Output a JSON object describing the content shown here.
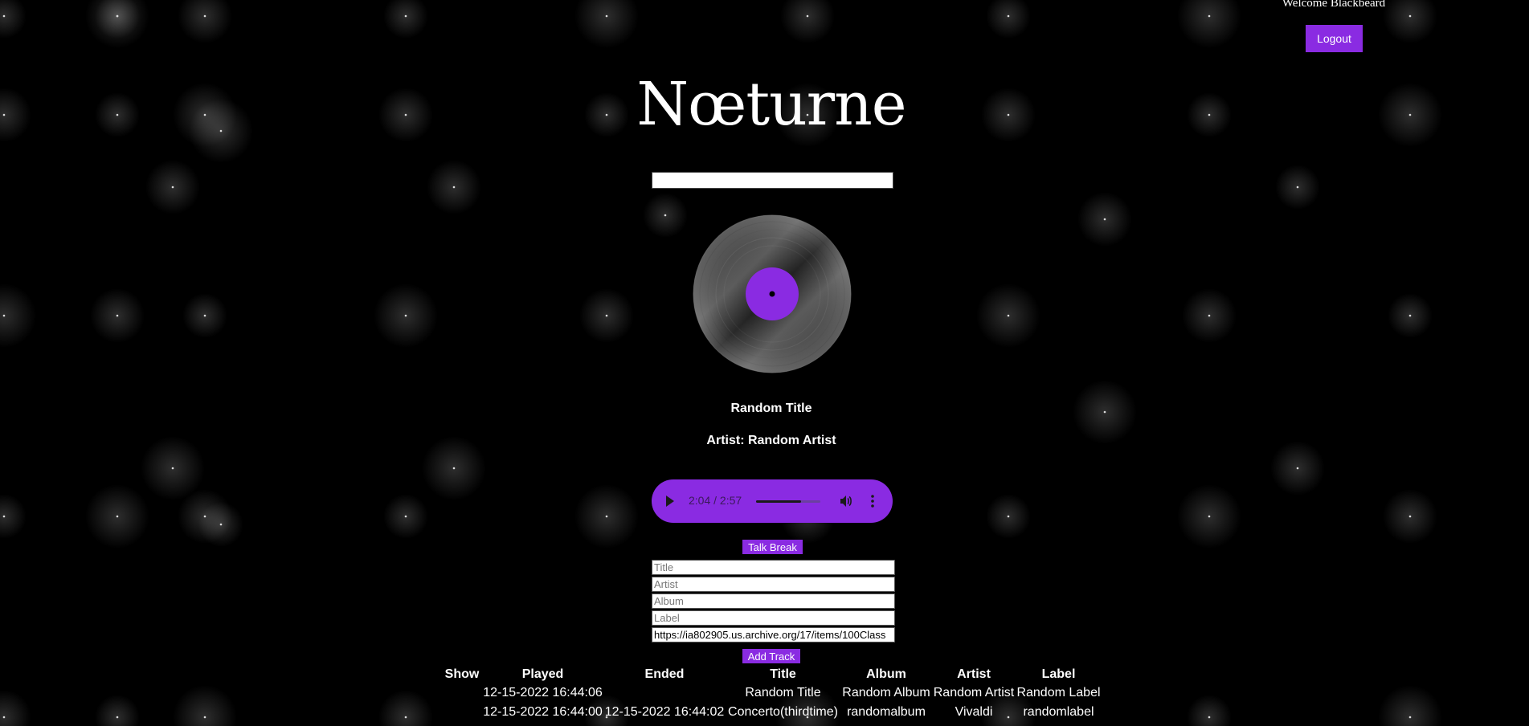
{
  "header": {
    "welcome_text": "Welcome Blackbeard",
    "logout_label": "Logout"
  },
  "brand": {
    "logo_text": "Nœturne"
  },
  "search": {
    "value": "",
    "placeholder": ""
  },
  "now_playing": {
    "title": "Random Title",
    "artist_line": "Artist: Random Artist"
  },
  "player": {
    "time_display": "2:04 / 2:57",
    "progress_fraction": 0.7,
    "accent_color": "#8a2be2",
    "icons": [
      "play-icon",
      "volume-icon",
      "more-vert-icon"
    ]
  },
  "talk_break_label": "Talk Break",
  "add_track_form": {
    "title_placeholder": "Title",
    "artist_placeholder": "Artist",
    "album_placeholder": "Album",
    "label_placeholder": "Label",
    "url_value": "https://ia802905.us.archive.org/17/items/100Class"
  },
  "add_track_label": "Add Track",
  "history": {
    "headers": [
      "Show",
      "Played",
      "Ended",
      "Title",
      "Album",
      "Artist",
      "Label"
    ],
    "rows": [
      [
        "",
        "12-15-2022 16:44:06",
        "",
        "Random Title",
        "Random Album",
        "Random Artist",
        "Random Label"
      ],
      [
        "",
        "12-15-2022 16:44:00",
        "12-15-2022 16:44:02",
        "Concerto(thirdtime)",
        "randomalbum",
        "Vivaldi",
        "randomlabel"
      ]
    ]
  }
}
